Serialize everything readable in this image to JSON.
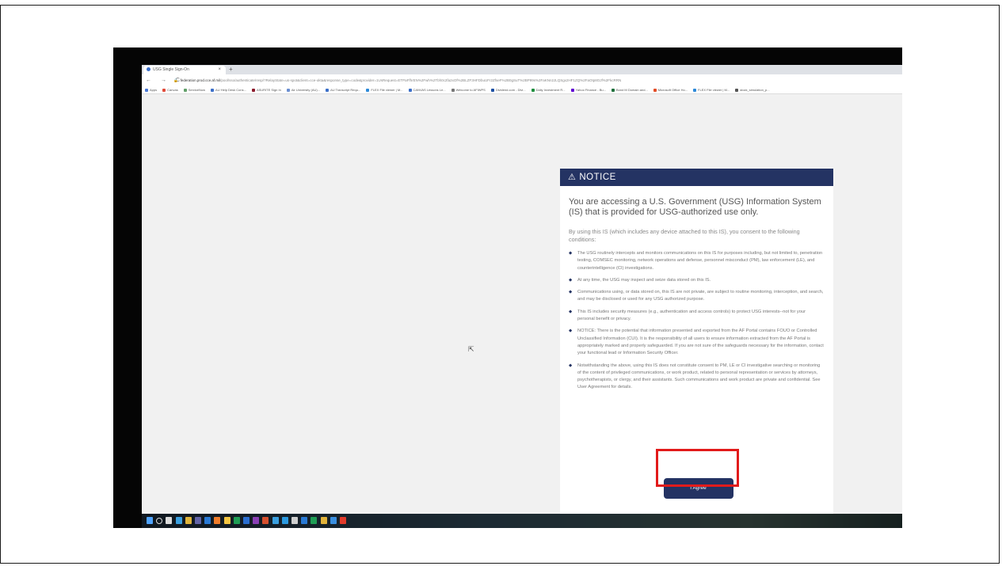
{
  "browser": {
    "tab_title": "USG Single Sign-On",
    "tab_close": "×",
    "new_tab": "+",
    "nav": "← → C",
    "lock": "🔒",
    "url_domain": "federation.prod.cce.af.mil",
    "url_rest": "/pool/sso/authenticate/resp/?RelayState=us-spot&client=cce-okta&response_type=code&provider=1UsRequest=ETPaFfhrEN%2Fwh%2Tbh0c2fa2xOf%2BLZF3HFDbuUFr2ZfseF%2B0gSuT%2BP99s%2FaKNn2JLQSgx2HF1ZQ%2FaOtp8OJf%2FkcRRN",
    "bookmarks": [
      {
        "label": "Apps",
        "color": "#4a79d6"
      },
      {
        "label": "Canvas",
        "color": "#e14b3a"
      },
      {
        "label": "ServiceNow",
        "color": "#62a06a"
      },
      {
        "label": "AU Help Desk Cons...",
        "color": "#3b6fc9"
      },
      {
        "label": "ASURITE Sign In",
        "color": "#8b1a2b"
      },
      {
        "label": "Air University (AU)...",
        "color": "#6b8fd1"
      },
      {
        "label": "AU Transcript Requ...",
        "color": "#3b6fc9"
      },
      {
        "label": "FLEX File viewer | M...",
        "color": "#2d8ad9"
      },
      {
        "label": "CANVAS Lessons Le...",
        "color": "#3b6fc9"
      },
      {
        "label": "Welcome to AFIWPS",
        "color": "#777777"
      },
      {
        "label": "Dividend.com - Divi...",
        "color": "#1c4fa3"
      },
      {
        "label": "Daily Investment R...",
        "color": "#1e8e3e"
      },
      {
        "label": "Yahoo Finance - Bu...",
        "color": "#6001d2"
      },
      {
        "label": "Bond M Domain and...",
        "color": "#1e6f3b"
      },
      {
        "label": "Microsoft Office Ho...",
        "color": "#e34c26"
      },
      {
        "label": "FLEX File viewer | M...",
        "color": "#2d8ad9"
      },
      {
        "label": "stock_simulation_p...",
        "color": "#555555"
      }
    ]
  },
  "notice": {
    "header": "NOTICE",
    "warning_icon": "⚠",
    "title": "You are accessing a U.S. Government (USG) Information System (IS) that is provided for USG-authorized use only.",
    "intro": "By using this IS (which includes any device attached to this IS), you consent to the following conditions:",
    "bullet_glyph": "◆",
    "conditions": [
      "The USG routinely intercepts and monitors communications on this IS for purposes including, but not limited to, penetration testing, COMSEC monitoring, network operations and defense, personnel misconduct (PM), law enforcement (LE), and counterintelligence (CI) investigations.",
      "At any time, the USG may inspect and seize data stored on this IS.",
      "Communications using, or data stored on, this IS are not private, are subject to routine monitoring, interception, and search, and may be disclosed or used for any USG authorized purpose.",
      "This IS includes security measures (e.g., authentication and access controls) to protect USG interests--not for your personal benefit or privacy.",
      "NOTICE: There is the potential that information presented and exported from the AF Portal contains FOUO or Controlled Unclassified Information (CUI). It is the responsibility of all users to ensure information extracted from the AF Portal is appropriately marked and properly safeguarded. If you are not sure of the safeguards necessary for the information, contact your functional lead or Information Security Officer.",
      "Notwithstanding the above, using this IS does not constitute consent to PM, LE or CI investigative searching or monitoring of the content of privileged communications, or work product, related to personal representation or services by attorneys, psychotherapists, or clergy, and their assistants. Such communications and work product are private and confidential. See User Agreement for details."
    ],
    "agree_label": "I Agree"
  },
  "cursor_glyph": "⇱",
  "taskbar": {
    "icons": [
      {
        "name": "start-icon",
        "color": "#4fa3ff"
      },
      {
        "name": "search-icon",
        "color": "#dcdcdc"
      },
      {
        "name": "task-view-icon",
        "color": "#dcdcdc"
      },
      {
        "name": "edge-icon",
        "color": "#3aa0e0"
      },
      {
        "name": "chrome-icon",
        "color": "#e0b43a"
      },
      {
        "name": "teams-icon",
        "color": "#6264a7"
      },
      {
        "name": "outlook-icon",
        "color": "#2a7ad5"
      },
      {
        "name": "firefox-icon",
        "color": "#f07d2b"
      },
      {
        "name": "file-explorer-icon",
        "color": "#f4c542"
      },
      {
        "name": "excel-icon",
        "color": "#1f9e55"
      },
      {
        "name": "word-icon",
        "color": "#2b6fd1"
      },
      {
        "name": "onenote-icon",
        "color": "#8a3fb5"
      },
      {
        "name": "powerpoint-icon",
        "color": "#d6502f"
      },
      {
        "name": "store-icon",
        "color": "#3aa0e0"
      },
      {
        "name": "photos-icon",
        "color": "#2b9ae0"
      },
      {
        "name": "settings-icon",
        "color": "#cfcfcf"
      },
      {
        "name": "mail-icon",
        "color": "#2a7ad5"
      },
      {
        "name": "maps-icon",
        "color": "#1f9e55"
      },
      {
        "name": "chrome-alt-icon",
        "color": "#e2b33a"
      },
      {
        "name": "vpn-icon",
        "color": "#3a8fe0"
      },
      {
        "name": "acrobat-icon",
        "color": "#e23b2b"
      }
    ]
  }
}
